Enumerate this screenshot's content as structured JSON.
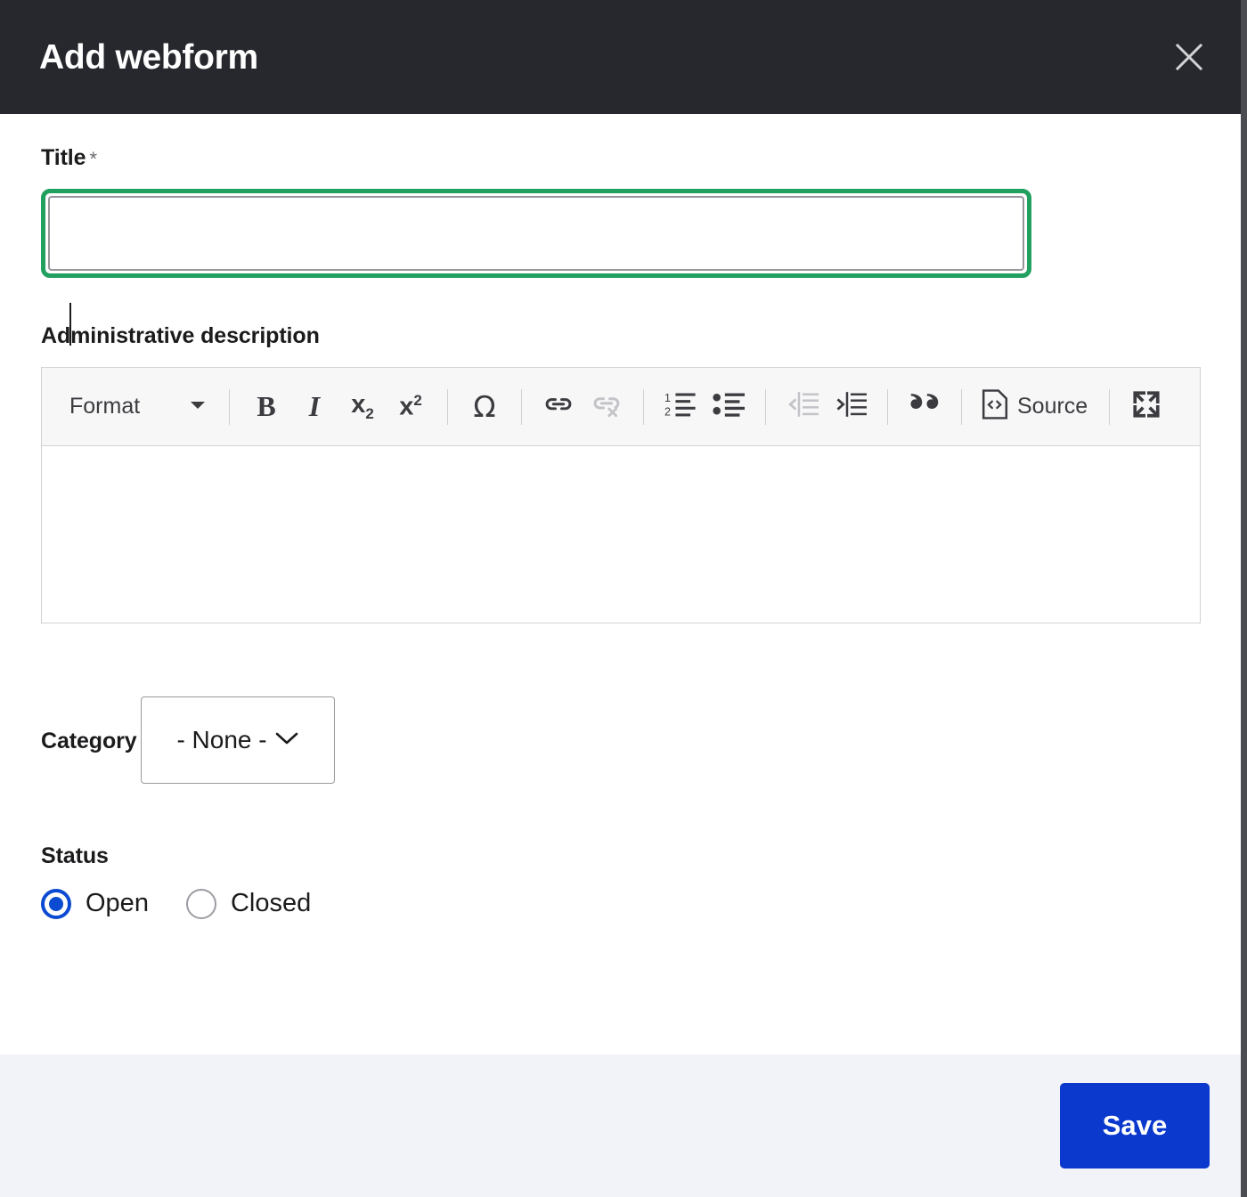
{
  "dialog": {
    "title": "Add webform",
    "close_icon": "close-icon",
    "header_bg": "#26282d",
    "focus_ring_color": "#22a060",
    "accent_blue": "#0b39cd"
  },
  "fields": {
    "title": {
      "label": "Title",
      "required_marker": "*",
      "value": "",
      "placeholder": ""
    },
    "administrative_description": {
      "label": "Administrative description",
      "value": "",
      "toolbar": {
        "format_label": "Format",
        "format_caret_icon": "chevron-down-icon",
        "buttons": [
          {
            "name": "bold-button",
            "glyph": "B",
            "label": "Bold",
            "disabled": false
          },
          {
            "name": "italic-button",
            "glyph": "I",
            "label": "Italic",
            "disabled": false
          },
          {
            "name": "subscript-button",
            "glyph": "x",
            "sub": "2",
            "label": "Subscript",
            "disabled": false
          },
          {
            "name": "superscript-button",
            "glyph": "x",
            "sup": "2",
            "label": "Superscript",
            "disabled": false
          },
          {
            "name": "special-character-button",
            "glyph": "Ω",
            "label": "Special character",
            "disabled": false
          },
          {
            "name": "link-button",
            "glyph": "link-icon",
            "label": "Link",
            "disabled": false
          },
          {
            "name": "unlink-button",
            "glyph": "unlink-icon",
            "label": "Unlink",
            "disabled": true
          },
          {
            "name": "numbered-list-button",
            "glyph": "numbered-list-icon",
            "label": "Insert/Remove Numbered List",
            "disabled": false
          },
          {
            "name": "bulleted-list-button",
            "glyph": "bulleted-list-icon",
            "label": "Insert/Remove Bulleted List",
            "disabled": false
          },
          {
            "name": "outdent-button",
            "glyph": "outdent-icon",
            "label": "Decrease Indent",
            "disabled": true
          },
          {
            "name": "indent-button",
            "glyph": "indent-icon",
            "label": "Increase Indent",
            "disabled": false
          },
          {
            "name": "blockquote-button",
            "glyph": "quote-icon",
            "label": "Block Quote",
            "disabled": false
          }
        ],
        "source_label": "Source",
        "source_icon": "source-code-icon",
        "maximize_icon": "maximize-icon"
      }
    },
    "category": {
      "label": "Category",
      "selected": "- None -",
      "caret_icon": "chevron-down-icon"
    },
    "status": {
      "label": "Status",
      "options": [
        {
          "label": "Open",
          "checked": true
        },
        {
          "label": "Closed",
          "checked": false
        }
      ]
    }
  },
  "footer": {
    "save_label": "Save"
  }
}
